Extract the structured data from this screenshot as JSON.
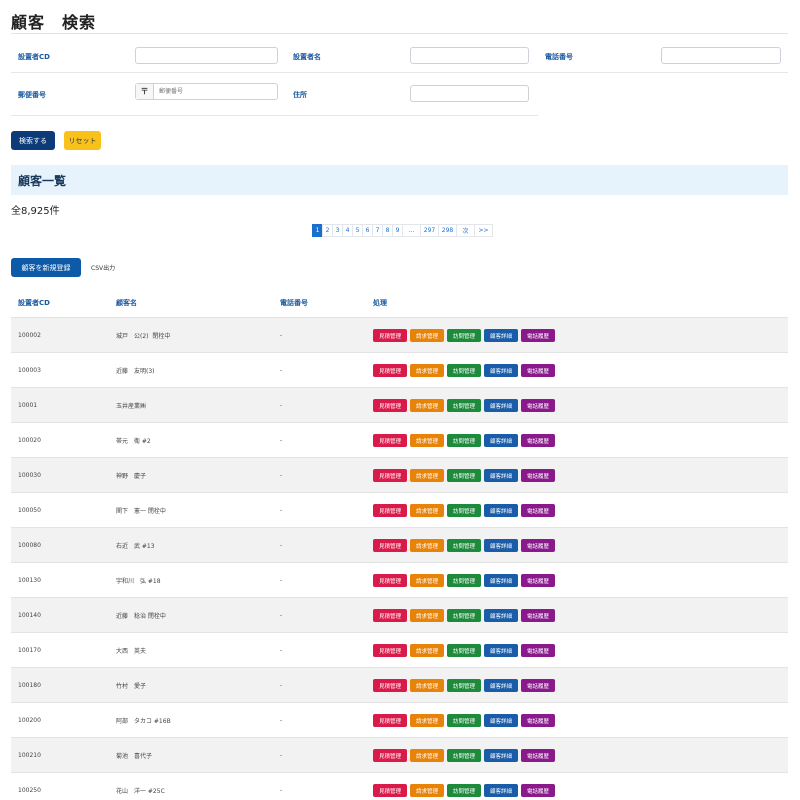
{
  "page": {
    "title": "顧客　検索"
  },
  "search_form": {
    "fields": {
      "installer_cd": {
        "label": "設置者CD",
        "value": ""
      },
      "installer_name": {
        "label": "設置者名",
        "value": ""
      },
      "phone": {
        "label": "電話番号",
        "value": ""
      },
      "postal_code": {
        "label": "郵便番号",
        "value": "",
        "placeholder": "郵便番号",
        "icon_glyph": "〒"
      },
      "address": {
        "label": "住所",
        "value": ""
      }
    },
    "search_button": "検索する",
    "reset_button": "リセット"
  },
  "list": {
    "heading": "顧客一覧",
    "total": "全8,925件",
    "pagination": [
      "1",
      "2",
      "3",
      "4",
      "5",
      "6",
      "7",
      "8",
      "9",
      "...",
      "297",
      "298",
      "次",
      ">>"
    ],
    "active_page": "1",
    "new_button": "顧客を新規登録",
    "csv_link": "CSV出力",
    "columns": [
      "設置者CD",
      "顧客名",
      "電話番号",
      "処理"
    ],
    "action_labels": {
      "mitsumori": "見積管理",
      "seikyu": "請求管理",
      "homon": "訪問管理",
      "shosai": "顧客詳細",
      "rireki": "電話履歴"
    },
    "rows": [
      {
        "cd": "100002",
        "name": "城戸　公(2)  閉栓中",
        "tel": "-"
      },
      {
        "cd": "100003",
        "name": "近藤　友明(3)",
        "tel": "-"
      },
      {
        "cd": "10001",
        "name": "玉井産業㈱",
        "tel": "-"
      },
      {
        "cd": "100020",
        "name": "帯元　衛 #2",
        "tel": "-"
      },
      {
        "cd": "100030",
        "name": "神野　慶子",
        "tel": "-"
      },
      {
        "cd": "100050",
        "name": "関下　憲一 閉栓中",
        "tel": "-"
      },
      {
        "cd": "100080",
        "name": "右近　武 #13",
        "tel": "-"
      },
      {
        "cd": "100130",
        "name": "宇和川　弘 #18",
        "tel": "-"
      },
      {
        "cd": "100140",
        "name": "近藤　稔治 閉栓中",
        "tel": "-"
      },
      {
        "cd": "100170",
        "name": "大西　英夫",
        "tel": "-"
      },
      {
        "cd": "100180",
        "name": "竹村　愛子",
        "tel": "-"
      },
      {
        "cd": "100200",
        "name": "阿部　タカコ #16B",
        "tel": "-"
      },
      {
        "cd": "100210",
        "name": "菊池　喜代子",
        "tel": "-"
      },
      {
        "cd": "100250",
        "name": "花山　洋一 #25C",
        "tel": "-"
      }
    ]
  }
}
